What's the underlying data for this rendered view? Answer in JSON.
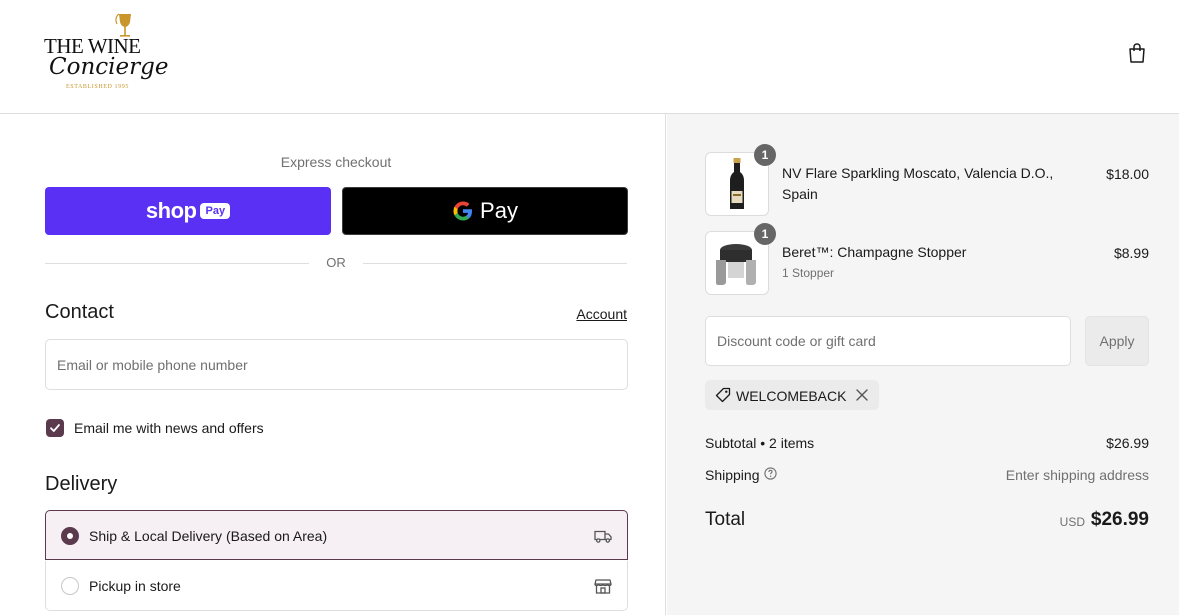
{
  "brand": {
    "line1": "THE WINE",
    "line2": "Concierge",
    "line3": "ESTABLISHED 1995"
  },
  "express": {
    "label": "Express checkout",
    "shop_word": "shop",
    "shop_pay": "Pay",
    "gpay_word": "Pay",
    "or": "OR"
  },
  "contact": {
    "title": "Contact",
    "account_link": "Account",
    "email_placeholder": "Email or mobile phone number",
    "newsletter_label": "Email me with news and offers",
    "newsletter_checked": true
  },
  "delivery": {
    "title": "Delivery",
    "options": [
      {
        "label": "Ship & Local Delivery (Based on Area)",
        "selected": true,
        "icon": "truck-icon"
      },
      {
        "label": "Pickup in store",
        "selected": false,
        "icon": "store-icon"
      }
    ]
  },
  "cart": {
    "items": [
      {
        "name_line1": "NV Flare Sparkling Moscato, Valencia D.O.,",
        "name_line2": "Spain",
        "quantity": "1",
        "price": "$18.00"
      },
      {
        "name": "Beret™: Champagne Stopper",
        "variant": "1 Stopper",
        "quantity": "1",
        "price": "$8.99"
      }
    ]
  },
  "discount": {
    "placeholder": "Discount code or gift card",
    "apply_label": "Apply",
    "applied_code": "WELCOMEBACK"
  },
  "summary": {
    "subtotal_label": "Subtotal • 2 items",
    "subtotal_value": "$26.99",
    "shipping_label": "Shipping",
    "shipping_value": "Enter shipping address",
    "total_label": "Total",
    "currency": "USD",
    "total_value": "$26.99"
  },
  "colors": {
    "shop_pay": "#5a31f4",
    "accent": "#5b3a4e",
    "summary_bg": "#f5f5f5"
  }
}
